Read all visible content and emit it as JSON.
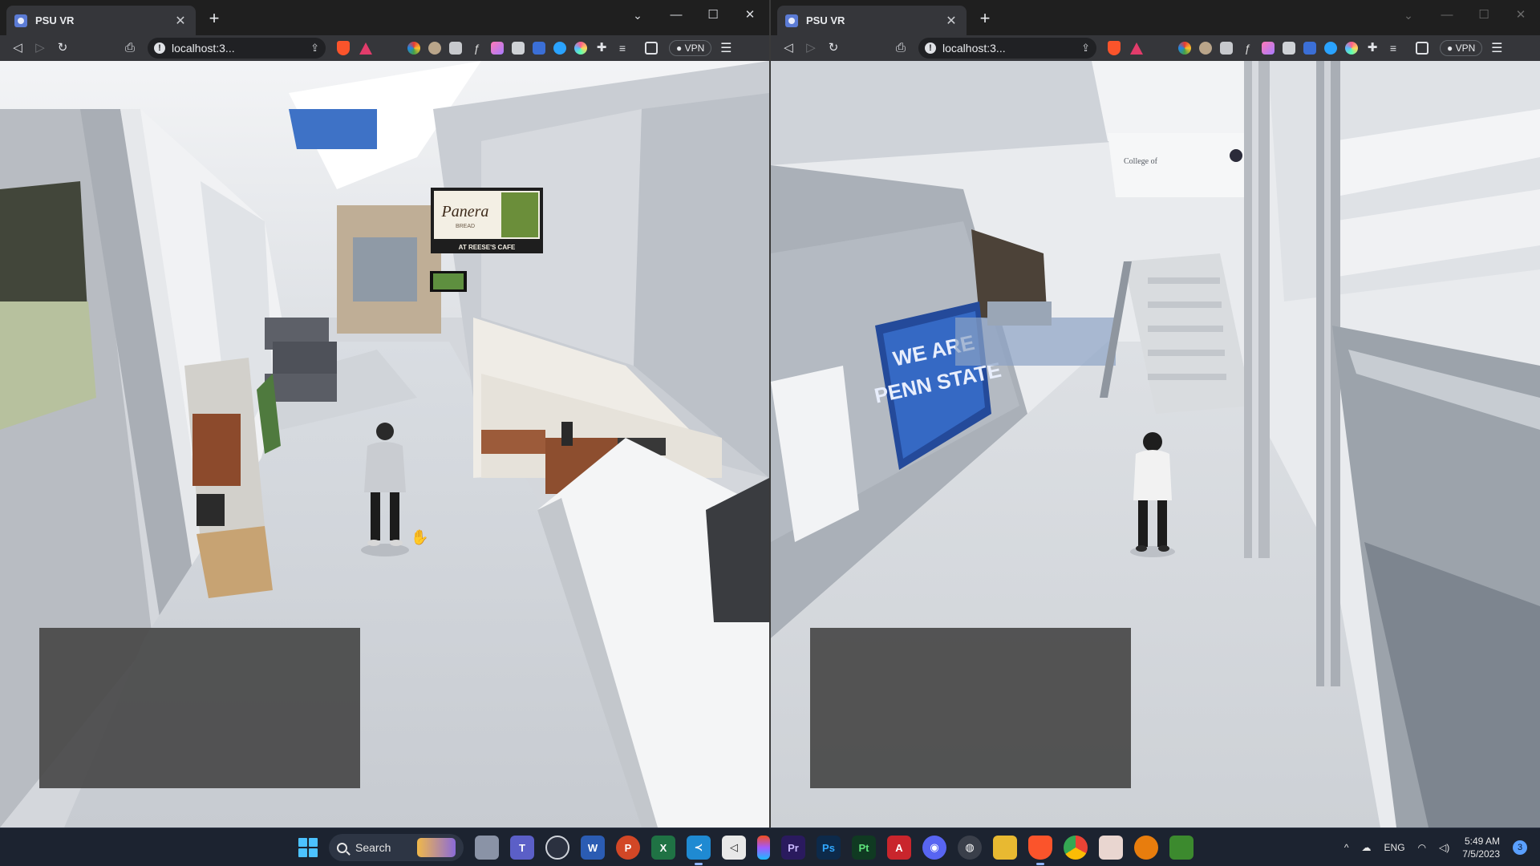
{
  "windows": [
    {
      "tab_title": "PSU VR",
      "url": "localhost:3...",
      "vpn_label": "VPN",
      "scene": {
        "cafe_sign_brand": "Panera",
        "cafe_sign_sub": "BREAD",
        "cafe_sign_location": "AT REESE'S CAFE"
      }
    },
    {
      "tab_title": "PSU VR",
      "url": "localhost:3...",
      "vpn_label": "VPN",
      "scene": {
        "banner_line1": "WE ARE",
        "banner_line2": "PENN STATE",
        "wall_text": "College of"
      }
    }
  ],
  "icons": {
    "back": "arrow-left-icon",
    "forward": "arrow-right-icon",
    "reload": "reload-icon",
    "bookmark": "bookmark-icon",
    "site_info": "info-icon",
    "share": "share-icon",
    "brave_shield": "brave-shield-icon",
    "brave_rewards": "brave-rewards-icon",
    "menu": "hamburger-menu-icon"
  },
  "taskbar": {
    "search_label": "Search",
    "language": "ENG",
    "time": "5:49 AM",
    "date": "7/5/2023",
    "notification_count": "3",
    "apps": [
      {
        "name": "file-explorer-app",
        "label": "",
        "color": "#8a93a6"
      },
      {
        "name": "teams-app",
        "label": "T",
        "color": "#5b5fc7"
      },
      {
        "name": "github-app",
        "label": "",
        "color": "#2b3140"
      },
      {
        "name": "word-app",
        "label": "W",
        "color": "#2b5cb3"
      },
      {
        "name": "powerpoint-app",
        "label": "P",
        "color": "#d24726"
      },
      {
        "name": "excel-app",
        "label": "X",
        "color": "#1f7244"
      },
      {
        "name": "vscode-app",
        "label": "",
        "color": "#1f8ad2"
      },
      {
        "name": "unity-app",
        "label": "",
        "color": "#3a3f4a"
      },
      {
        "name": "figma-app",
        "label": "",
        "color": "#2b3140"
      },
      {
        "name": "premiere-app",
        "label": "Pr",
        "color": "#2a1a5e"
      },
      {
        "name": "photoshop-app",
        "label": "Ps",
        "color": "#0d2a4a"
      },
      {
        "name": "substance-app",
        "label": "Pt",
        "color": "#103a22"
      },
      {
        "name": "acrobat-app",
        "label": "",
        "color": "#c9252c"
      },
      {
        "name": "discord-app",
        "label": "",
        "color": "#5865f2"
      },
      {
        "name": "obs-app",
        "label": "",
        "color": "#3a3f4a"
      },
      {
        "name": "folder-app",
        "label": "",
        "color": "#e8b931"
      },
      {
        "name": "brave-app",
        "label": "",
        "color": "#fb542b"
      },
      {
        "name": "chrome-app",
        "label": "",
        "color": "#1a73e8"
      },
      {
        "name": "anime-app",
        "label": "",
        "color": "#e9d6d0"
      },
      {
        "name": "blender-app",
        "label": "",
        "color": "#e87d0d"
      },
      {
        "name": "minecraft-app",
        "label": "",
        "color": "#3c8a2e"
      }
    ]
  }
}
